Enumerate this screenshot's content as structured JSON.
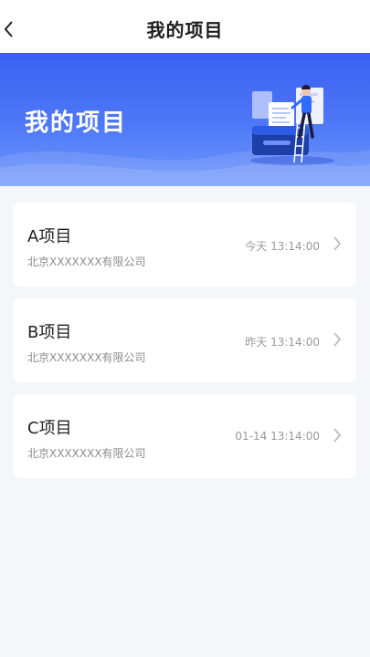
{
  "header": {
    "title": "我的项目"
  },
  "banner": {
    "title": "我的项目"
  },
  "projects": [
    {
      "name": "A项目",
      "company": "北京XXXXXXX有限公司",
      "time": "今天 13:14:00"
    },
    {
      "name": "B项目",
      "company": "北京XXXXXXX有限公司",
      "time": "昨天 13:14:00"
    },
    {
      "name": "C项目",
      "company": "北京XXXXXXX有限公司",
      "time": "01-14 13:14:00"
    }
  ],
  "colors": {
    "accent": "#3b60f2",
    "background": "#f4f6fa"
  },
  "icons": {
    "back": "chevron-left-icon",
    "row": "chevron-right-icon"
  }
}
